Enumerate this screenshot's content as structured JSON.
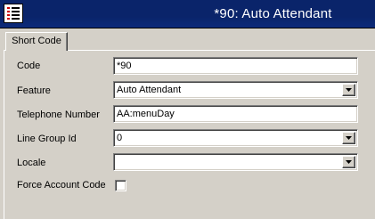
{
  "window": {
    "title": "*90: Auto Attendant",
    "icon": "list-icon"
  },
  "tabs": [
    {
      "label": "Short Code",
      "selected": true
    }
  ],
  "form": {
    "code": {
      "label": "Code",
      "value": "*90"
    },
    "feature": {
      "label": "Feature",
      "value": "Auto Attendant"
    },
    "telephone_number": {
      "label": "Telephone Number",
      "value": "AA:menuDay"
    },
    "line_group_id": {
      "label": "Line Group Id",
      "value": "0"
    },
    "locale": {
      "label": "Locale",
      "value": ""
    },
    "force_account_code": {
      "label": "Force Account Code",
      "checked": false
    }
  },
  "colors": {
    "titlebar": "#0a246a",
    "background": "#d4d0c8",
    "icon_accent": "#cc0000"
  }
}
